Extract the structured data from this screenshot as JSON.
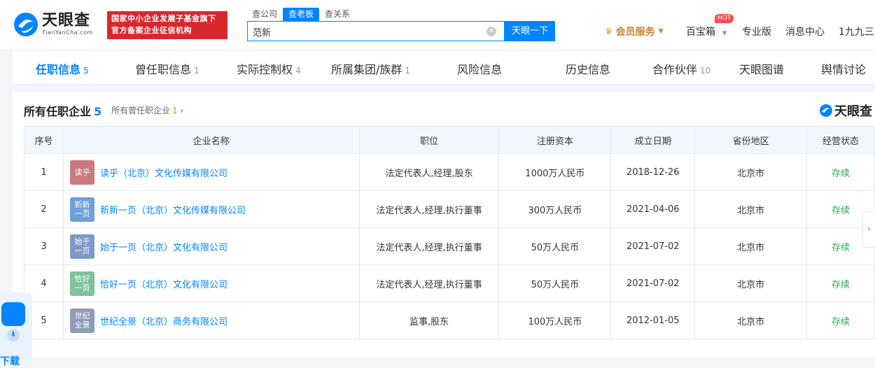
{
  "header": {
    "logo_cn": "天眼查",
    "logo_en": "TianYanCha.com",
    "banner_line1": "国家中小企业发展子基金旗下",
    "banner_line2": "官方备案企业征信机构",
    "search_tabs": [
      "查公司",
      "查老板",
      "查关系"
    ],
    "search_value": "范新",
    "search_button": "天眼一下",
    "member_label": "会员服务",
    "baibao": "百宝箱",
    "hot_badge": "HOT",
    "pro": "专业版",
    "messages": "消息中心",
    "user": "1九九三"
  },
  "tabs": [
    {
      "label": "任职信息",
      "count": "5"
    },
    {
      "label": "曾任职信息",
      "count": "1"
    },
    {
      "label": "实际控制权",
      "count": "4"
    },
    {
      "label": "所属集团/族群",
      "count": "1"
    },
    {
      "label": "风险信息",
      "count": ""
    },
    {
      "label": "历史信息",
      "count": ""
    },
    {
      "label": "合作伙伴",
      "count": "10"
    },
    {
      "label": "天眼图谱",
      "count": ""
    },
    {
      "label": "舆情讨论",
      "count": ""
    }
  ],
  "section": {
    "title": "所有任职企业",
    "count": "5",
    "former_label": "所有曾任职企业",
    "former_count": "1",
    "watermark": "天眼查"
  },
  "table": {
    "headers": [
      "序号",
      "企业名称",
      "职位",
      "注册资本",
      "成立日期",
      "省份地区",
      "经营状态"
    ],
    "rows": [
      {
        "no": "1",
        "logo_line1": "读乎",
        "logo_line2": "",
        "logo_color": "#c97a7e",
        "name": "读乎（北京）文化传媒有限公司",
        "position": "法定代表人,经理,股东",
        "capital": "1000万人民币",
        "date": "2018-12-26",
        "region": "北京市",
        "status": "存续"
      },
      {
        "no": "2",
        "logo_line1": "新新",
        "logo_line2": "一页",
        "logo_color": "#6ea0d9",
        "name": "新新一页（北京）文化传媒有限公司",
        "position": "法定代表人,经理,执行董事",
        "capital": "300万人民币",
        "date": "2021-04-06",
        "region": "北京市",
        "status": "存续"
      },
      {
        "no": "3",
        "logo_line1": "始于",
        "logo_line2": "一页",
        "logo_color": "#7d9ac7",
        "name": "始于一页（北京）文化有限公司",
        "position": "法定代表人,经理,执行董事",
        "capital": "50万人民币",
        "date": "2021-07-02",
        "region": "北京市",
        "status": "存续"
      },
      {
        "no": "4",
        "logo_line1": "恰好",
        "logo_line2": "一页",
        "logo_color": "#7fc29b",
        "name": "恰好一页（北京）文化有限公司",
        "position": "法定代表人,经理,执行董事",
        "capital": "50万人民币",
        "date": "2021-07-02",
        "region": "北京市",
        "status": "存续"
      },
      {
        "no": "5",
        "logo_line1": "世纪",
        "logo_line2": "全景",
        "logo_color": "#8e9bb8",
        "name": "世纪全景（北京）商务有限公司",
        "position": "监事,股东",
        "capital": "100万人民币",
        "date": "2012-01-05",
        "region": "北京市",
        "status": "存续"
      }
    ]
  },
  "widget": {
    "text": "下载"
  },
  "colors": {
    "accent": "#0084ff",
    "banner": "#d9272e",
    "active_status": "#26a659"
  }
}
